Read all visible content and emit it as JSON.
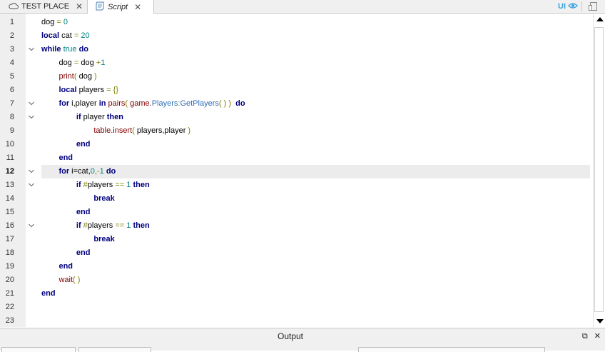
{
  "tabs": [
    {
      "label": "TEST PLACE",
      "icon": "cloud-icon"
    },
    {
      "label": "Script",
      "icon": "script-icon"
    }
  ],
  "toolbar": {
    "ui_label": "UI",
    "ui_icon": "eye-icon",
    "device_icon": "device-icon"
  },
  "colors": {
    "keyword": "#00007f",
    "number": "#007f7f",
    "operator": "#7f7f00",
    "function": "#7f0000",
    "builtin": "#2e6cb8",
    "accent": "#3ba4e0"
  },
  "editor": {
    "current_line": 12,
    "folded_lines": [
      3,
      7,
      8,
      12,
      13,
      16
    ],
    "lines": [
      [
        {
          "t": "dog",
          "c": "id"
        },
        {
          "t": " = ",
          "c": "op"
        },
        {
          "t": "0",
          "c": "num"
        }
      ],
      [
        {
          "t": "local",
          "c": "kw"
        },
        {
          "t": " cat ",
          "c": "id"
        },
        {
          "t": "=",
          "c": "op"
        },
        {
          "t": " 20",
          "c": "num"
        }
      ],
      [
        {
          "t": "while",
          "c": "kw"
        },
        {
          "t": " true",
          "c": "num"
        },
        {
          "t": " do",
          "c": "kw"
        }
      ],
      [
        {
          "t": "        dog ",
          "c": "id"
        },
        {
          "t": "=",
          "c": "op"
        },
        {
          "t": " dog ",
          "c": "id"
        },
        {
          "t": "+",
          "c": "op"
        },
        {
          "t": "1",
          "c": "num"
        }
      ],
      [
        {
          "t": "        print",
          "c": "fn"
        },
        {
          "t": "(",
          "c": "op"
        },
        {
          "t": " dog ",
          "c": "id"
        },
        {
          "t": ")",
          "c": "op"
        }
      ],
      [
        {
          "t": "        local",
          "c": "kw"
        },
        {
          "t": " players ",
          "c": "id"
        },
        {
          "t": "=",
          "c": "op"
        },
        {
          "t": " {}",
          "c": "op"
        }
      ],
      [
        {
          "t": "        for",
          "c": "kw"
        },
        {
          "t": " i,player ",
          "c": "id"
        },
        {
          "t": "in",
          "c": "kw"
        },
        {
          "t": " pairs",
          "c": "fn"
        },
        {
          "t": "(",
          "c": "op"
        },
        {
          "t": " game.",
          "c": "fn"
        },
        {
          "t": "Players",
          "c": "bi"
        },
        {
          "t": ":",
          "c": "op"
        },
        {
          "t": "GetPlayers",
          "c": "bi"
        },
        {
          "t": "( ) ",
          "c": "op"
        },
        {
          "t": ") ",
          "c": "op"
        },
        {
          "t": " do",
          "c": "kw"
        }
      ],
      [
        {
          "t": "                if",
          "c": "kw"
        },
        {
          "t": " player ",
          "c": "id"
        },
        {
          "t": "then",
          "c": "kw"
        }
      ],
      [
        {
          "t": "                        table.insert",
          "c": "fn"
        },
        {
          "t": "(",
          "c": "op"
        },
        {
          "t": " players,player ",
          "c": "id"
        },
        {
          "t": ")",
          "c": "op"
        }
      ],
      [
        {
          "t": "                end",
          "c": "kw"
        }
      ],
      [
        {
          "t": "        end",
          "c": "kw"
        }
      ],
      [
        {
          "t": "        for",
          "c": "kw"
        },
        {
          "t": " i=cat,",
          "c": "id"
        },
        {
          "t": "0",
          "c": "num"
        },
        {
          "t": ",-",
          "c": "op"
        },
        {
          "t": "1",
          "c": "num"
        },
        {
          "t": " do",
          "c": "kw"
        }
      ],
      [
        {
          "t": "                if",
          "c": "kw"
        },
        {
          "t": " #",
          "c": "op"
        },
        {
          "t": "players ",
          "c": "id"
        },
        {
          "t": "==",
          "c": "op"
        },
        {
          "t": " 1 ",
          "c": "num"
        },
        {
          "t": "then",
          "c": "kw"
        }
      ],
      [
        {
          "t": "                        break",
          "c": "kw"
        }
      ],
      [
        {
          "t": "                end",
          "c": "kw"
        }
      ],
      [
        {
          "t": "                if",
          "c": "kw"
        },
        {
          "t": " #",
          "c": "op"
        },
        {
          "t": "players ",
          "c": "id"
        },
        {
          "t": "==",
          "c": "op"
        },
        {
          "t": " 1 ",
          "c": "num"
        },
        {
          "t": "then",
          "c": "kw"
        }
      ],
      [
        {
          "t": "                        break",
          "c": "kw"
        }
      ],
      [
        {
          "t": "                end",
          "c": "kw"
        }
      ],
      [
        {
          "t": "        end",
          "c": "kw"
        }
      ],
      [
        {
          "t": "        wait",
          "c": "fn"
        },
        {
          "t": "( )",
          "c": "op"
        }
      ],
      [
        {
          "t": "end",
          "c": "kw"
        }
      ],
      [],
      []
    ]
  },
  "output": {
    "title": "Output",
    "icons": [
      "restore-icon",
      "close-icon"
    ]
  }
}
